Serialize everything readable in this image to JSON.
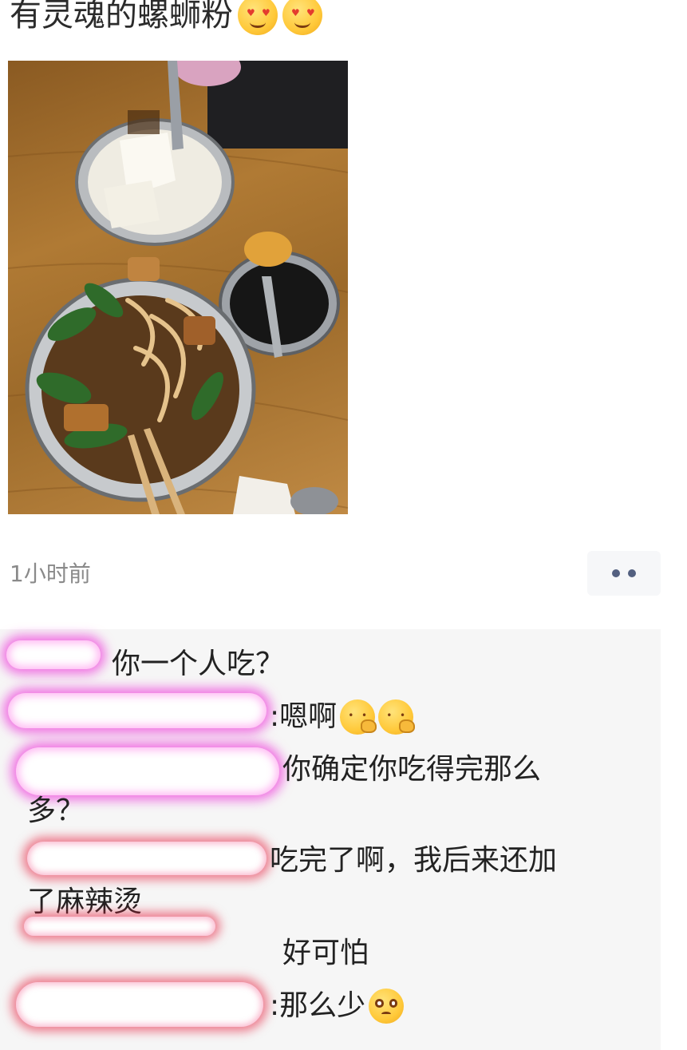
{
  "post": {
    "text": "有灵魂的螺蛳粉",
    "emojis": [
      "heart-eyes-emoji",
      "heart-eyes-emoji"
    ]
  },
  "photo": {
    "subject": "food-photo"
  },
  "meta": {
    "timestamp": "1小时前",
    "more_icon": "more-dots-icon"
  },
  "comments": [
    {
      "text": "你一个人吃？"
    },
    {
      "text": ":嗯啊",
      "emojis": [
        "thinking-hand-emoji",
        "thinking-hand-emoji"
      ]
    },
    {
      "text": "你确定你吃得完那么",
      "continuation": "多？"
    },
    {
      "text": "吃完了啊，我后来还加",
      "continuation": "了麻辣烫"
    },
    {
      "text": "好可怕"
    },
    {
      "text": ":那么少",
      "emojis": [
        "pleading-emoji"
      ]
    }
  ],
  "colors": {
    "text": "#2b2b2b",
    "muted": "#8a8a8a",
    "comment_bg": "#f6f6f6",
    "more_dots": "#536080",
    "redaction_magenta": "#eb00d2"
  }
}
